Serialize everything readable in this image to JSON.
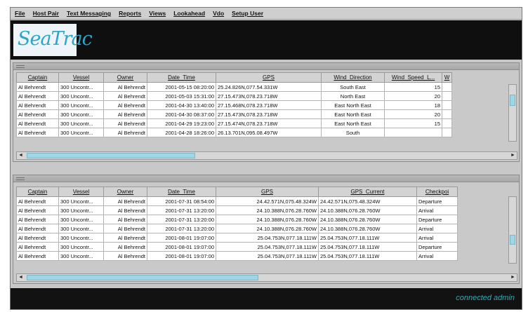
{
  "menu": [
    "File",
    "Host Pair",
    "Text Messaging",
    "Reports",
    "Views",
    "Lookahead",
    "Vdo",
    "Setup User"
  ],
  "logo": "SeaTrac",
  "voyage_table": {
    "headers": [
      "Captain",
      "Vessel",
      "Owner",
      "Date_Time",
      "GPS",
      "Wind_Direction",
      "Wind_Speed_L...",
      "W"
    ],
    "rows": [
      [
        "Al Behrendt",
        "300 Uncontr...",
        "Al Behrendt",
        "2001-05-15 08:20:00",
        "25.24.826N,077.54.331W",
        "South East",
        "15"
      ],
      [
        "Al Behrendt",
        "300 Uncontr...",
        "Al Behrendt",
        "2001-05-03 15:31:00",
        "27.15.473N,078.23.718W",
        "North East",
        "20"
      ],
      [
        "Al Behrendt",
        "300 Uncontr...",
        "Al Behrendt",
        "2001-04-30 13:40:00",
        "27.15.468N,078.23.718W",
        "East North East",
        "18"
      ],
      [
        "Al Behrendt",
        "300 Uncontr...",
        "Al Behrendt",
        "2001-04-30 08:37:00",
        "27.15.473N,078.23.718W",
        "East North East",
        "20"
      ],
      [
        "Al Behrendt",
        "300 Uncontr...",
        "Al Behrendt",
        "2001-04-29 19:23:00",
        "27.15.474N,078.23.718W",
        "East North East",
        "15"
      ],
      [
        "Al Behrendt",
        "300 Uncontr...",
        "Al Behrendt",
        "2001-04-28 18:26:00",
        "26.13.701N,095.08.497W",
        "South",
        ""
      ]
    ]
  },
  "events_table": {
    "headers": [
      "Captain",
      "Vessel",
      "Owner",
      "Date_Time",
      "GPS",
      "GPS_Current",
      "Checkpoi"
    ],
    "rows": [
      [
        "Al Behrendt",
        "300 Uncontr...",
        "Al Behrendt",
        "2001-07-31 08:54:00",
        "24.42.571N,075.48.324W",
        "24.42.571N,075.48.324W",
        "Departure"
      ],
      [
        "Al Behrendt",
        "300 Uncontr...",
        "Al Behrendt",
        "2001-07-31 13:20:00",
        "24.10.388N,076.28.760W",
        "24.10.388N,076.28.760W",
        "Arrival"
      ],
      [
        "Al Behrendt",
        "300 Uncontr...",
        "Al Behrendt",
        "2001-07-31 13:20:00",
        "24.10.388N,076.28.760W",
        "24.10.388N,076.28.760W",
        "Departure"
      ],
      [
        "Al Behrendt",
        "300 Uncontr...",
        "Al Behrendt",
        "2001-07-31 13:20:00",
        "24.10.388N,076.28.760W",
        "24.10.388N,076.28.760W",
        "Arrival"
      ],
      [
        "Al Behrendt",
        "300 Uncontr...",
        "Al Behrendt",
        "2001-08-01 19:07:00",
        "25.04.753N,077.18.111W",
        "25.04.753N,077.18.111W",
        "Arrival"
      ],
      [
        "Al Behrendt",
        "300 Uncontr...",
        "Al Behrendt",
        "2001-08-01 19:07:00",
        "25.04.753N,077.18.111W",
        "25.04.753N,077.18.111W",
        "Departure"
      ],
      [
        "Al Behrendt",
        "300 Uncontr...",
        "Al Behrendt",
        "2001-08-01 19:07:00",
        "25.04.753N,077.18.111W",
        "25.04.753N,077.18.111W",
        "Arrival"
      ]
    ]
  },
  "status": "connected admin",
  "colors": {
    "accent": "#2aa6c7",
    "header_bg": "#0f0f0f",
    "scroll_thumb": "#9fd6e6"
  }
}
